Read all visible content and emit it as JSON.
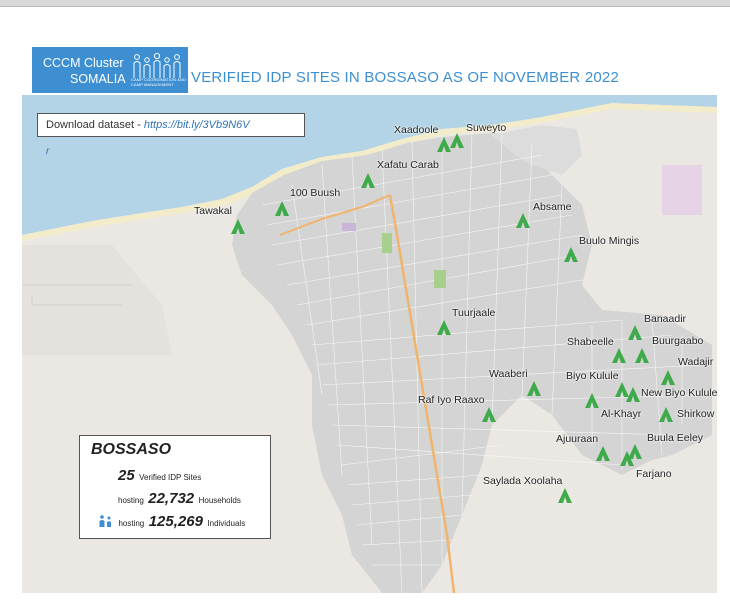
{
  "header": {
    "cluster_line1": "CCCM Cluster",
    "cluster_line2": "SOMALIA",
    "cluster_sub": "CAMP COORDINATION AND CAMP MANAGEMENT",
    "title": "VERIFIED IDP SITES IN BOSSASO AS OF NOVEMBER 2022"
  },
  "download": {
    "label": "Download dataset - ",
    "link": "https://bit.ly/3Vb9N6V",
    "trail": "r"
  },
  "places": {
    "xaadoole": "Xaadoole",
    "suweyto": "Suweyto",
    "xafatu_carab": "Xafatu Carab",
    "buush": "100 Buush",
    "tawakal": "Tawakal",
    "absame": "Absame",
    "buulo_mingis": "Buulo Mingis",
    "tuurjaale": "Tuurjaale",
    "banaadir": "Banaadir",
    "shabeelle": "Shabeelle",
    "buurgaabo": "Buurgaabo",
    "wadajir": "Wadajir",
    "waaberi": "Waaberi",
    "biyo_kulule": "Biyo Kulule",
    "new_biyo_kulule": "New Biyo Kulule",
    "raf_iyo_raaxo": "Raf Iyo Raaxo",
    "al_khayr": "Al-Khayr",
    "shirkow": "Shirkow",
    "ajuuraan": "Ajuuraan",
    "buula_eeley": "Buula Eeley",
    "farjano": "Farjano",
    "saylada_xoolaha": "Saylada Xoolaha"
  },
  "summary": {
    "city": "BOSSASO",
    "sites_value": "25",
    "sites_label": "Verified IDP Sites",
    "hh_prefix": "hosting",
    "hh_value": "22,732",
    "hh_label": "Households",
    "ind_prefix": "hosting",
    "ind_value": "125,269",
    "ind_label": "Individuals"
  },
  "icons": {
    "tent": "tent-icon",
    "people": "people-icon"
  },
  "colors": {
    "brand_blue": "#3d8fd1",
    "sea": "#b3d4e6",
    "land": "#ebe8e3",
    "urban": "#d4d4d4",
    "tent_green": "#3faa4a",
    "road": "#f0b46c"
  }
}
